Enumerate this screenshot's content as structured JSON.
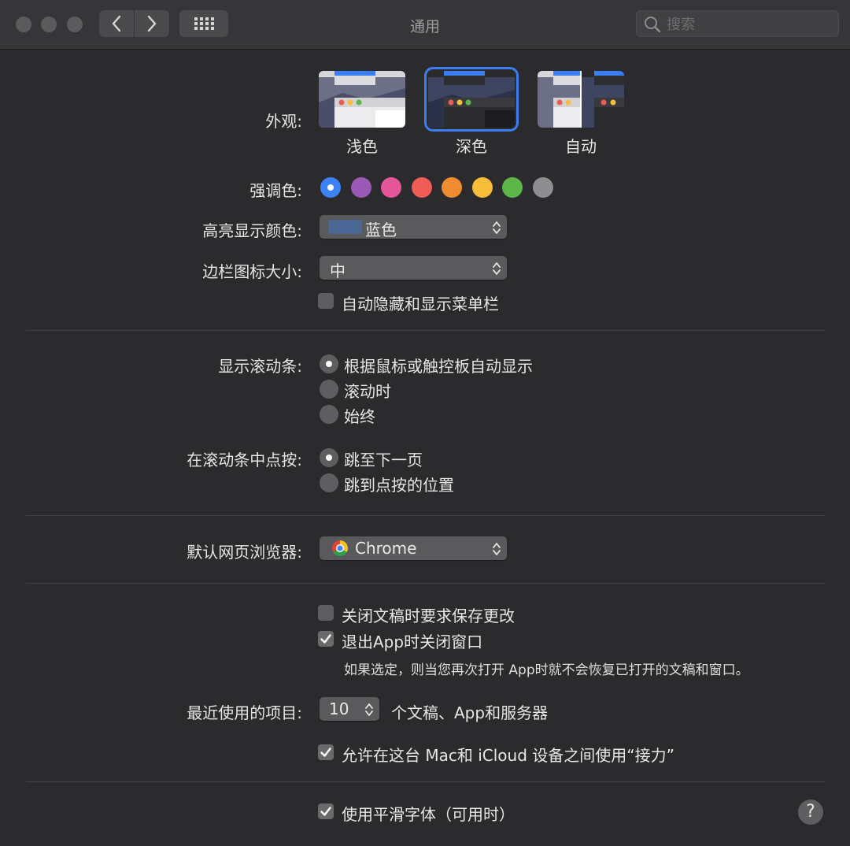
{
  "window": {
    "title": "通用"
  },
  "search": {
    "placeholder": "搜索"
  },
  "appearance": {
    "label": "外观:",
    "options": [
      {
        "label": "浅色"
      },
      {
        "label": "深色",
        "selected": true
      },
      {
        "label": "自动"
      }
    ]
  },
  "accent": {
    "label": "强调色:",
    "colors": [
      "#3b82f6",
      "#9b59b6",
      "#e5559a",
      "#ef5b57",
      "#f08b32",
      "#f6bd3a",
      "#5db64a",
      "#8e8e90"
    ],
    "selected": 0
  },
  "highlight": {
    "label": "高亮显示颜色:",
    "value": "蓝色",
    "swatch": "#4a6893"
  },
  "sidebar_icon": {
    "label": "边栏图标大小:",
    "value": "中"
  },
  "autohide_menubar": {
    "label": "自动隐藏和显示菜单栏",
    "checked": false
  },
  "scrollbars": {
    "label": "显示滚动条:",
    "options": [
      "根据鼠标或触控板自动显示",
      "滚动时",
      "始终"
    ],
    "selected": 0
  },
  "click_scrollbar": {
    "label": "在滚动条中点按:",
    "options": [
      "跳至下一页",
      "跳到点按的位置"
    ],
    "selected": 0
  },
  "browser": {
    "label": "默认网页浏览器:",
    "value": "Chrome"
  },
  "ask_keep_changes": {
    "label": "关闭文稿时要求保存更改",
    "checked": false
  },
  "close_windows": {
    "label": "退出App时关闭窗口",
    "checked": true,
    "note": "如果选定，则当您再次打开 App时就不会恢复已打开的文稿和窗口。"
  },
  "recent_items": {
    "label": "最近使用的项目:",
    "value": "10",
    "suffix": "个文稿、App和服务器"
  },
  "handoff": {
    "label": "允许在这台 Mac和 iCloud 设备之间使用“接力”",
    "checked": true
  },
  "font_smoothing": {
    "label": "使用平滑字体（可用时）",
    "checked": true
  },
  "help": {
    "label": "?"
  }
}
